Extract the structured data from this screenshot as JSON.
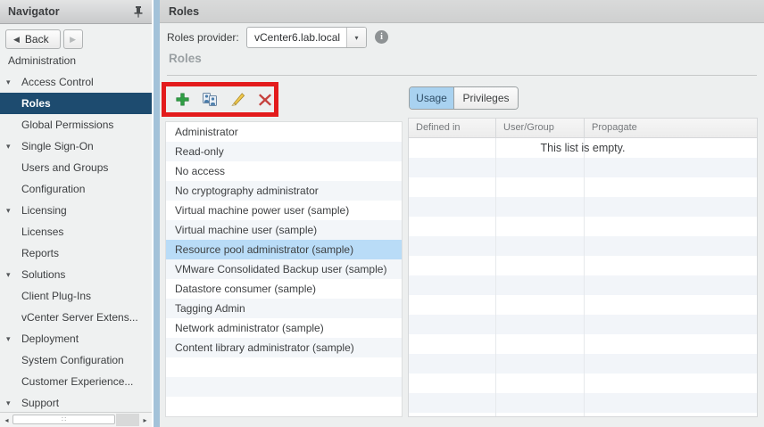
{
  "navigator": {
    "title": "Navigator",
    "back_label": "Back",
    "items": [
      {
        "label": "Administration",
        "root": true,
        "arrow": false,
        "selected": false
      },
      {
        "label": "Access Control",
        "root": false,
        "arrow": true,
        "selected": false
      },
      {
        "label": "Roles",
        "root": false,
        "arrow": false,
        "selected": true
      },
      {
        "label": "Global Permissions",
        "root": false,
        "arrow": false,
        "selected": false
      },
      {
        "label": "Single Sign-On",
        "root": false,
        "arrow": true,
        "selected": false
      },
      {
        "label": "Users and Groups",
        "root": false,
        "arrow": false,
        "selected": false
      },
      {
        "label": "Configuration",
        "root": false,
        "arrow": false,
        "selected": false
      },
      {
        "label": "Licensing",
        "root": false,
        "arrow": true,
        "selected": false
      },
      {
        "label": "Licenses",
        "root": false,
        "arrow": false,
        "selected": false
      },
      {
        "label": "Reports",
        "root": false,
        "arrow": false,
        "selected": false
      },
      {
        "label": "Solutions",
        "root": false,
        "arrow": true,
        "selected": false
      },
      {
        "label": "Client Plug-Ins",
        "root": false,
        "arrow": false,
        "selected": false
      },
      {
        "label": "vCenter Server Extens...",
        "root": false,
        "arrow": false,
        "selected": false
      },
      {
        "label": "Deployment",
        "root": false,
        "arrow": true,
        "selected": false
      },
      {
        "label": "System Configuration",
        "root": false,
        "arrow": false,
        "selected": false
      },
      {
        "label": "Customer Experience...",
        "root": false,
        "arrow": false,
        "selected": false
      },
      {
        "label": "Support",
        "root": false,
        "arrow": true,
        "selected": false
      }
    ]
  },
  "content_header": {
    "title": "Roles"
  },
  "provider": {
    "label": "Roles provider:",
    "value": "vCenter6.lab.local"
  },
  "roles_section": {
    "title": "Roles"
  },
  "toolbar": {
    "buttons": [
      "add-role-icon",
      "clone-role-icon",
      "edit-role-icon",
      "delete-role-icon"
    ]
  },
  "tabs": [
    {
      "label": "Usage",
      "selected": true
    },
    {
      "label": "Privileges",
      "selected": false
    }
  ],
  "roles_list": {
    "items": [
      "Administrator",
      "Read-only",
      "No access",
      "No cryptography administrator",
      "Virtual machine power user (sample)",
      "Virtual machine user (sample)",
      "Resource pool administrator (sample)",
      "VMware Consolidated Backup user (sample)",
      "Datastore consumer (sample)",
      "Tagging Admin",
      "Network administrator (sample)",
      "Content library administrator (sample)"
    ],
    "selected_index": 6,
    "trailing_empty_rows": 3
  },
  "usage_table": {
    "columns": [
      "Defined in",
      "User/Group",
      "Propagate"
    ],
    "empty_message": "This list is empty.",
    "rows": []
  },
  "icons": {
    "back_arrow": "◀",
    "forward_arrow": "▶",
    "tree_arrow": "▾",
    "dropdown_arrow": "▾",
    "info_glyph": "i",
    "scroll_left": "◂",
    "scroll_right": "▸",
    "grip": "∷"
  },
  "colors": {
    "nav_selected_bg": "#1d4b6f",
    "row_selected_bg": "#b9dcf7",
    "tab_selected_bg": "#a9d2f0",
    "annotation_red": "#e31b1c",
    "divider_blue": "#a3c2d9",
    "add_green": "#2f9e44",
    "delete_red": "#c5413d",
    "pencil_yellow": "#f2c94c"
  }
}
